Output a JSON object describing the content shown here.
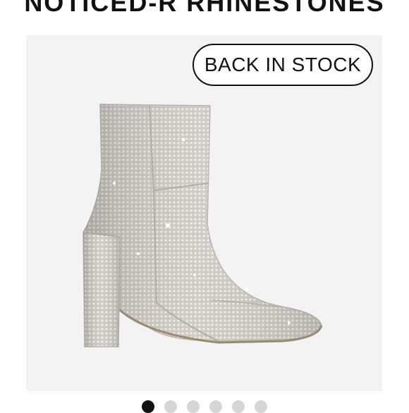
{
  "product": {
    "title": "NOTICED-R RHINESTONES",
    "badge": "BACK IN STOCK",
    "image_icon": "rhinestone-ankle-boot"
  },
  "carousel": {
    "total": 6,
    "current": 1
  },
  "colors": {
    "text": "#111111",
    "panel": "#f4f3f3",
    "dot_active": "#111111",
    "dot_inactive": "#d6d6d6"
  }
}
